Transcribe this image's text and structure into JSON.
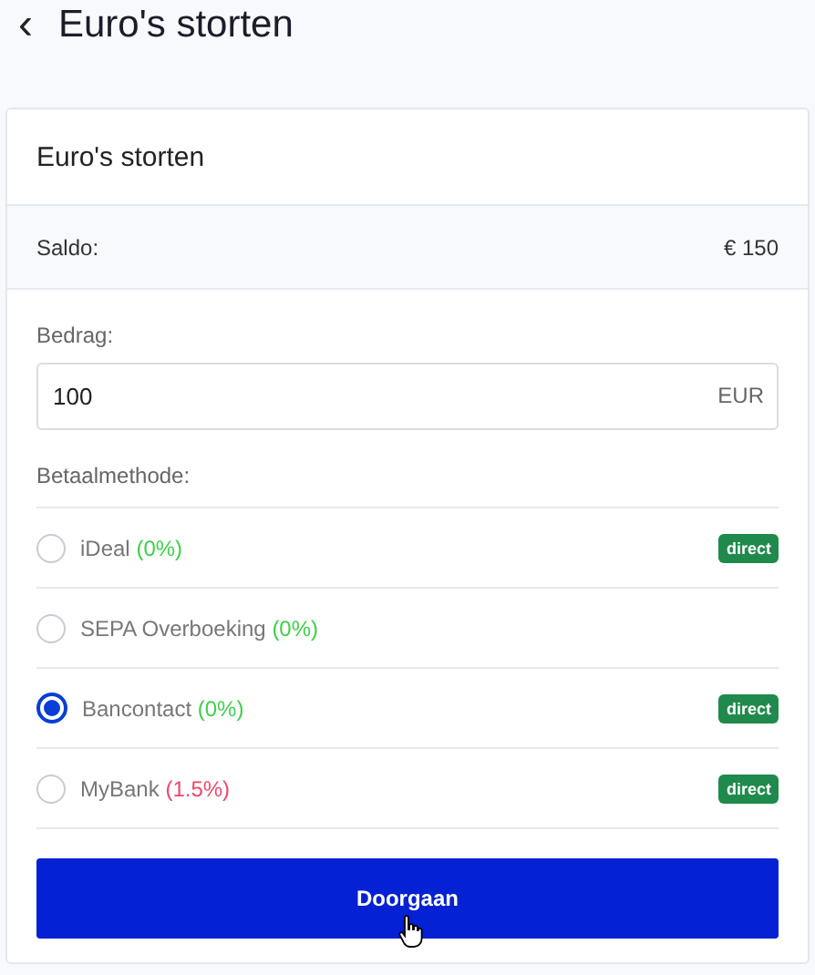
{
  "header": {
    "back": "‹",
    "title": "Euro's storten"
  },
  "card": {
    "title": "Euro's storten",
    "balance": {
      "label": "Saldo:",
      "value": "€ 150"
    },
    "amount": {
      "label": "Bedrag:",
      "value": "100",
      "unit": "EUR"
    },
    "method_label": "Betaalmethode:",
    "methods": [
      {
        "name": "iDeal",
        "fee": "(0%)",
        "color": "#3ecf4a",
        "badge": "direct",
        "selected": false
      },
      {
        "name": "SEPA Overboeking",
        "fee": "(0%)",
        "color": "#3ecf4a",
        "selected": false
      },
      {
        "name": "Bancontact",
        "fee": "(0%)",
        "color": "#3ecf4a",
        "badge": "direct",
        "selected": true
      },
      {
        "name": "MyBank",
        "fee": "(1.5%)",
        "color": "#f0466a",
        "badge": "direct",
        "selected": false
      }
    ],
    "button": "Doorgaan"
  }
}
